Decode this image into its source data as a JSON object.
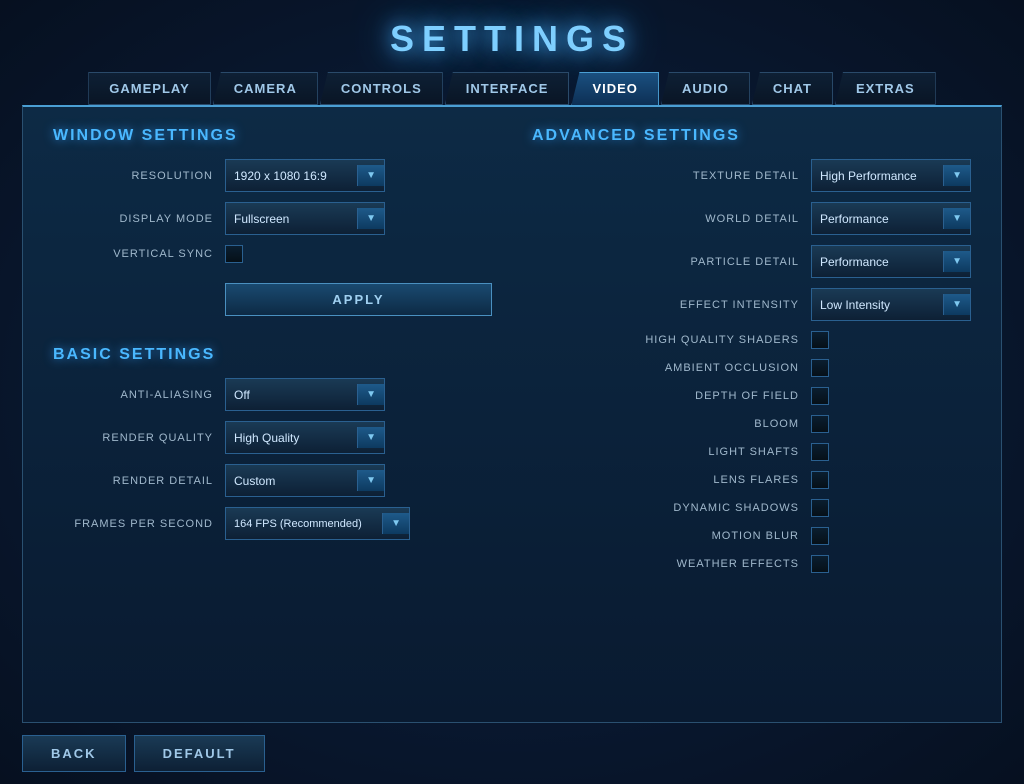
{
  "title": "SETTINGS",
  "tabs": [
    {
      "id": "gameplay",
      "label": "GAMEPLAY",
      "active": false
    },
    {
      "id": "camera",
      "label": "CAMERA",
      "active": false
    },
    {
      "id": "controls",
      "label": "CONTROLS",
      "active": false
    },
    {
      "id": "interface",
      "label": "INTERFACE",
      "active": false
    },
    {
      "id": "video",
      "label": "VIDEO",
      "active": true
    },
    {
      "id": "audio",
      "label": "AUDIO",
      "active": false
    },
    {
      "id": "chat",
      "label": "CHAT",
      "active": false
    },
    {
      "id": "extras",
      "label": "EXTRAS",
      "active": false
    }
  ],
  "window_settings": {
    "header": "WINDOW SETTINGS",
    "resolution_label": "RESOLUTION",
    "resolution_value": "1920 x 1080 16:9",
    "display_mode_label": "DISPLAY MODE",
    "display_mode_value": "Fullscreen",
    "vertical_sync_label": "VERTICAL SYNC",
    "apply_label": "APPLY"
  },
  "basic_settings": {
    "header": "BASIC SETTINGS",
    "anti_aliasing_label": "ANTI-ALIASING",
    "anti_aliasing_value": "Off",
    "render_quality_label": "RENDER QUALITY",
    "render_quality_value": "High Quality",
    "render_detail_label": "RENDER DETAIL",
    "render_detail_value": "Custom",
    "fps_label": "FRAMES PER SECOND",
    "fps_value": "164  FPS (Recommended)"
  },
  "advanced_settings": {
    "header": "ADVANCED SETTINGS",
    "texture_detail_label": "TEXTURE DETAIL",
    "texture_detail_value": "High Performance",
    "world_detail_label": "WORLD DETAIL",
    "world_detail_value": "Performance",
    "particle_detail_label": "PARTICLE DETAIL",
    "particle_detail_value": "Performance",
    "effect_intensity_label": "EFFECT INTENSITY",
    "effect_intensity_value": "Low Intensity",
    "high_quality_shaders_label": "HIGH QUALITY SHADERS",
    "ambient_occlusion_label": "AMBIENT OCCLUSION",
    "depth_of_field_label": "DEPTH OF FIELD",
    "bloom_label": "BLOOM",
    "light_shafts_label": "LIGHT SHAFTS",
    "lens_flares_label": "LENS FLARES",
    "dynamic_shadows_label": "DYNAMIC SHADOWS",
    "motion_blur_label": "MOTION BLUR",
    "weather_effects_label": "WEATHER EFFECTS"
  },
  "bottom": {
    "back_label": "BACK",
    "default_label": "DEFAULT"
  }
}
